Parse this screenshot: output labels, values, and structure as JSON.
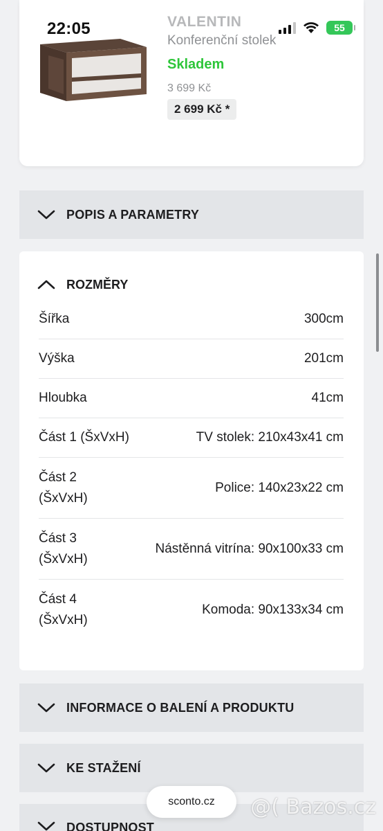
{
  "status_bar": {
    "time": "22:05",
    "battery": "55"
  },
  "product": {
    "brand": "VALENTIN",
    "subtitle": "Konferenční stolek",
    "stock": "Skladem",
    "old_price": "3 699 Kč",
    "new_price": "2 699 Kč *"
  },
  "sections": {
    "description": "POPIS A PARAMETRY",
    "dimensions": "ROZMĚRY",
    "packaging": "INFORMACE O BALENÍ A PRODUKTU",
    "download": "KE STAŽENÍ",
    "availability": "DOSTUPNOST"
  },
  "dimensions": {
    "rows": [
      {
        "label": "Šířka",
        "value": "300cm"
      },
      {
        "label": "Výška",
        "value": "201cm"
      },
      {
        "label": "Hloubka",
        "value": "41cm"
      },
      {
        "label": "Část 1 (ŠxVxH)",
        "value": "TV stolek: 210x43x41 cm"
      },
      {
        "label": "Část 2 (ŠxVxH)",
        "value": "Police: 140x23x22 cm"
      },
      {
        "label": "Část 3 (ŠxVxH)",
        "value": "Nástěnná vitrína: 90x100x33 cm"
      },
      {
        "label": "Část 4 (ŠxVxH)",
        "value": "Komoda: 90x133x34 cm"
      }
    ]
  },
  "footer": {
    "domain": "sconto.cz",
    "watermark": "@( Bazos.cz"
  },
  "colors": {
    "stock_green": "#2ec63a",
    "panel_gray": "#e3e5e8",
    "battery_green": "#34c759"
  }
}
